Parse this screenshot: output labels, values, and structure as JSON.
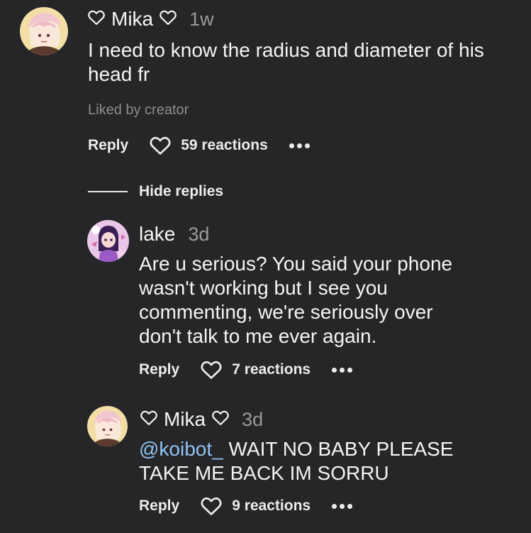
{
  "comment": {
    "author": "Mika",
    "time": "1w",
    "text": "I need to know the radius and diameter of his head fr",
    "liked_by": "Liked by creator",
    "reply_label": "Reply",
    "reactions": "59 reactions"
  },
  "hide_replies_label": "Hide replies",
  "replies": [
    {
      "author": "lake",
      "time": "3d",
      "text": "Are u serious? You said your phone wasn't working but I see you commenting, we're seriously over don't talk to me ever again.",
      "reply_label": "Reply",
      "reactions": "7 reactions"
    },
    {
      "author": "Mika",
      "time": "3d",
      "mention": "@koibot_",
      "text": " WAIT NO BABY PLEASE TAKE ME BACK IM SORRU",
      "reply_label": "Reply",
      "reactions": "9 reactions"
    }
  ],
  "icons": {
    "name_heart": "heart-outline-icon",
    "reaction": "heart-outline-icon",
    "more": "more-dots-icon"
  },
  "colors": {
    "background": "#262628",
    "mention": "#8fc3f1",
    "muted": "#9a9a9c"
  }
}
